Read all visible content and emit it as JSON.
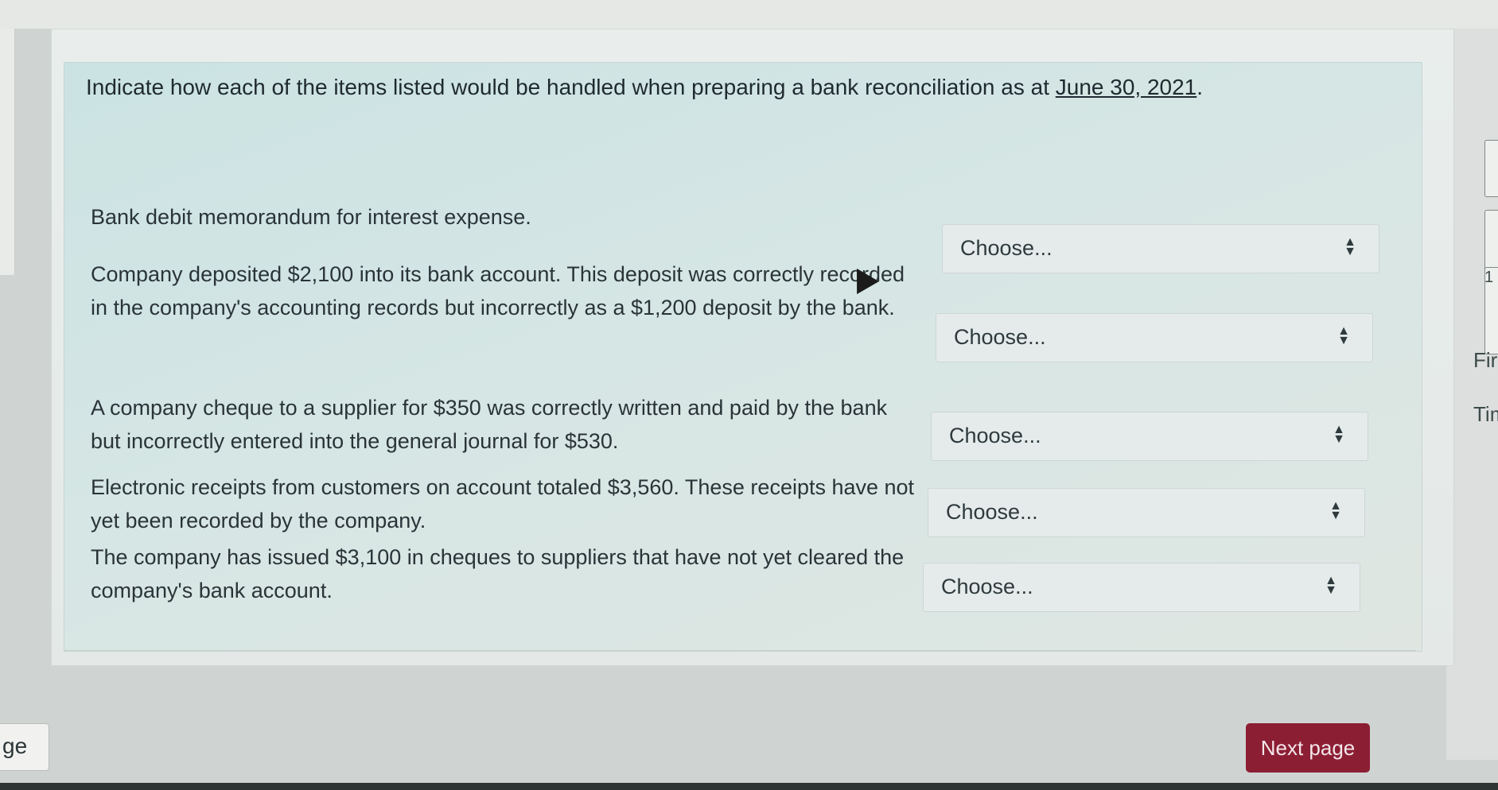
{
  "question": {
    "text_before": "Indicate how each of the items listed would be handled when preparing a bank reconciliation as at ",
    "date": "June 30, 2021",
    "text_after": "."
  },
  "items": [
    {
      "text": "Bank debit memorandum for interest expense.",
      "select_value": "Choose..."
    },
    {
      "text": "Company deposited $2,100 into its bank account. This deposit was correctly recorded in the company's accounting records but incorrectly as a $1,200 deposit by the bank.",
      "select_value": "Choose..."
    },
    {
      "text": "A company cheque to a supplier for $350 was correctly written and paid by the bank but incorrectly entered into the general journal for $530.",
      "select_value": "Choose..."
    },
    {
      "text": "Electronic receipts from customers on account totaled $3,560. These receipts have not yet been recorded by the company.",
      "select_value": "Choose..."
    },
    {
      "text": "The company has issued $3,100 in cheques to suppliers that have not yet cleared the company's bank account.",
      "select_value": "Choose..."
    }
  ],
  "navigation": {
    "previous_label": "ge",
    "next_label": "Next page"
  },
  "side_panel": {
    "number": "1",
    "label_1": "Fir",
    "label_2": "Tim"
  }
}
